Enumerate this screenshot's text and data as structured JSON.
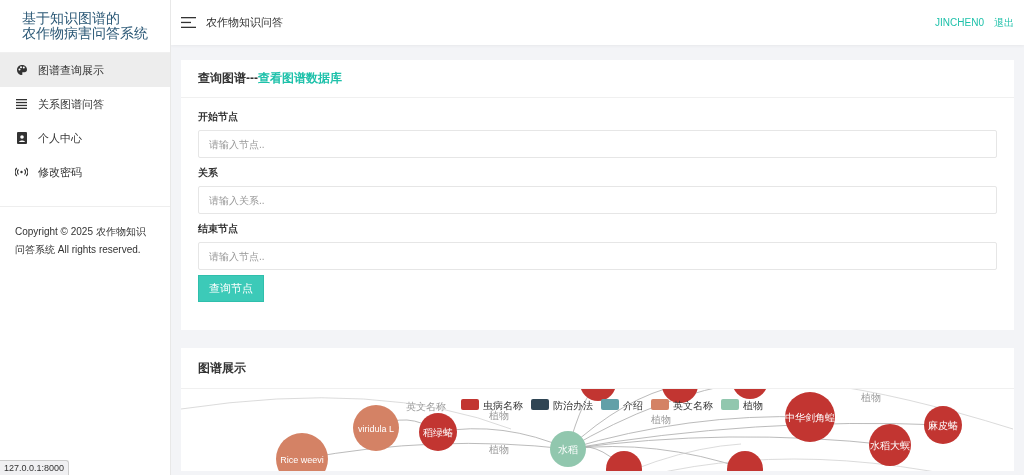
{
  "sidebar": {
    "title_lines": [
      "基于知识图谱的",
      "农作物病害问答系统"
    ],
    "items": [
      {
        "label": "图谱查询展示",
        "selected": true
      },
      {
        "label": "关系图谱问答",
        "selected": false
      },
      {
        "label": "个人中心",
        "selected": false
      },
      {
        "label": "修改密码",
        "selected": false
      }
    ],
    "copyright": "Copyright © 2025 农作物知识问答系统 All rights reserved."
  },
  "header": {
    "title": "农作物知识问答",
    "user": "JINCHEN0",
    "logout": "退出"
  },
  "query_card": {
    "title": "查询图谱---",
    "title_link": "查看图谱数据库",
    "fields": [
      {
        "label": "开始节点",
        "placeholder": "请输入节点.."
      },
      {
        "label": "关系",
        "placeholder": "请输入关系.."
      },
      {
        "label": "结束节点",
        "placeholder": "请输入节点.."
      }
    ],
    "button": "查询节点"
  },
  "graph_card": {
    "title": "图谱展示",
    "legend": [
      {
        "label": "虫病名称",
        "color": "#c23531"
      },
      {
        "label": "防治办法",
        "color": "#2f4554"
      },
      {
        "label": "介绍",
        "color": "#61a0a8"
      },
      {
        "label": "英文名称",
        "color": "#d48265"
      },
      {
        "label": "植物",
        "color": "#91c7ae"
      }
    ],
    "nodes": [
      {
        "label": "viridula L",
        "color": "#d48265"
      },
      {
        "label": "稻绿蝽",
        "color": "#c23531"
      },
      {
        "label": "Rice weevi",
        "color": "#d48265"
      },
      {
        "label": "水稻",
        "color": "#91c7ae"
      },
      {
        "label": "中华剑角蝗",
        "color": "#c23531"
      },
      {
        "label": "水稻大螟",
        "color": "#c23531"
      },
      {
        "label": "麻皮蝽",
        "color": "#c23531"
      },
      {
        "color": "#c23531"
      },
      {
        "color": "#c23531"
      },
      {
        "color": "#c23531"
      },
      {
        "color": "#c23531"
      },
      {
        "color": "#c23531"
      }
    ],
    "edges": [
      {
        "label": "英文名称"
      },
      {
        "label": "植物"
      },
      {
        "label": "植物"
      },
      {
        "label": "植物"
      },
      {
        "label": "植物"
      }
    ]
  },
  "status_url": "127.0.0.1:8000"
}
